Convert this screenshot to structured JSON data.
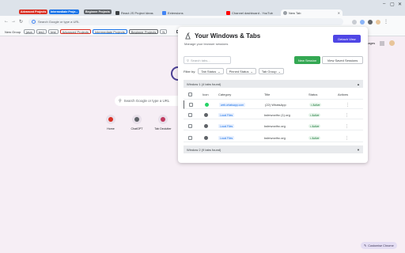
{
  "browser": {
    "tab_groups": [
      {
        "label": "Advanced Projects",
        "color": "#d93025"
      },
      {
        "label": "Intermediate Proje...",
        "color": "#1a73e8"
      },
      {
        "label": "Beginner Projects",
        "color": "#5f6368"
      }
    ],
    "tabs": [
      {
        "title": "React JS Project Ideas",
        "color": "#3c4043"
      },
      {
        "title": "Extensions",
        "color": "#4285f4"
      },
      {
        "title": "Channel dashboard - YouTub",
        "color": "#ff0000"
      },
      {
        "title": "New Tab",
        "color": "#5f6368"
      }
    ],
    "omnibox_placeholder": "Search Google or type a URL",
    "bookmarks": [
      "New Group",
      "java",
      "tes1",
      "test",
      "Advanced Projects",
      "Intermediate Projects",
      "Beginner Projects",
      "N"
    ],
    "bookmarks_folder": "Mi",
    "images_link": "Images"
  },
  "ntp": {
    "search_placeholder": "Search Google or type a URL",
    "shortcuts": [
      {
        "label": "Home",
        "color": "#d93025"
      },
      {
        "label": "ChatGPT",
        "color": "#5f6368"
      },
      {
        "label": "Tab Declutter",
        "color": "#c0395f"
      }
    ],
    "customize_label": "Customise Chrome"
  },
  "panel": {
    "title": "Your Windows & Tabs",
    "subtitle": "Manage your browser sessions",
    "detach_label": "Detach View",
    "search_placeholder": "Search tabs...",
    "new_session_label": "New Session",
    "view_saved_label": "View Saved Sessions",
    "filter_label": "Filter by:",
    "filters": [
      "Tab Status",
      "Pinned Status",
      "Tab Group"
    ],
    "windows": [
      {
        "label": "Window 1 (4 tabs found)",
        "toggle": "▲"
      },
      {
        "label": "Window 2 (9 tabs found)",
        "toggle": "▼"
      }
    ],
    "columns": [
      "Icon",
      "Category",
      "Title",
      "Status",
      "Actions"
    ],
    "rows": [
      {
        "category": "web.whatsapp.com",
        "title": "(22) WhatsApp",
        "status": "Active",
        "icon_color": "#25d366"
      },
      {
        "category": "Local Files",
        "title": "kshrwocthc (1).org",
        "status": "Active",
        "icon_color": "#5f6368"
      },
      {
        "category": "Local Files",
        "title": "kshrwocthc.org",
        "status": "Active",
        "icon_color": "#5f6368"
      },
      {
        "category": "Local Files",
        "title": "kshrwocthc.org",
        "status": "Active",
        "icon_color": "#5f6368"
      }
    ]
  }
}
